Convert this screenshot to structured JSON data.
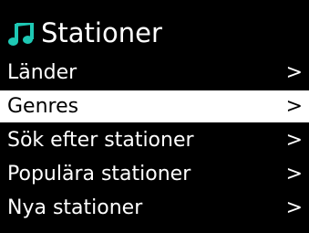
{
  "header": {
    "icon": "music-note-icon",
    "title": "Stationer",
    "icon_color": "#1ec8b4"
  },
  "menu": {
    "items": [
      {
        "label": "Länder",
        "arrow": ">",
        "selected": false
      },
      {
        "label": "Genres",
        "arrow": ">",
        "selected": true
      },
      {
        "label": "Sök efter stationer",
        "arrow": ">",
        "selected": false
      },
      {
        "label": "Populära stationer",
        "arrow": ">",
        "selected": false
      },
      {
        "label": "Nya stationer",
        "arrow": ">",
        "selected": false
      }
    ]
  },
  "colors": {
    "background": "#000000",
    "text": "#ffffff",
    "highlight": "#ffffff",
    "highlight_text": "#000000"
  }
}
